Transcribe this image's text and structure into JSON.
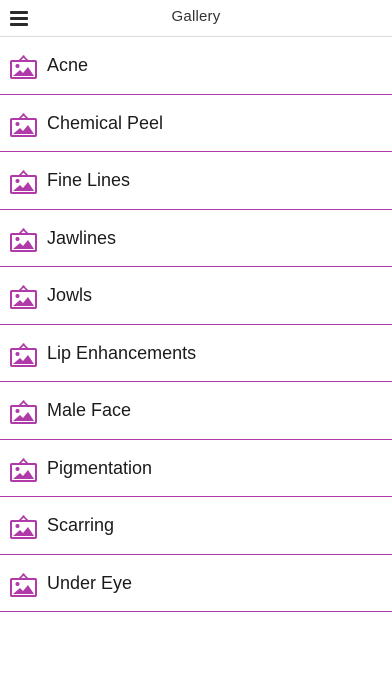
{
  "header": {
    "title": "Gallery",
    "menu_icon": "hamburger-menu-icon"
  },
  "colors": {
    "accent": "#b03aa7",
    "text": "#1a1a1a",
    "header_text": "#333333"
  },
  "gallery": {
    "item_icon": "image-frame-icon",
    "items": [
      {
        "label": "Acne"
      },
      {
        "label": "Chemical Peel"
      },
      {
        "label": "Fine Lines"
      },
      {
        "label": "Jawlines"
      },
      {
        "label": "Jowls"
      },
      {
        "label": "Lip Enhancements"
      },
      {
        "label": "Male Face"
      },
      {
        "label": "Pigmentation"
      },
      {
        "label": "Scarring"
      },
      {
        "label": "Under Eye"
      }
    ]
  }
}
